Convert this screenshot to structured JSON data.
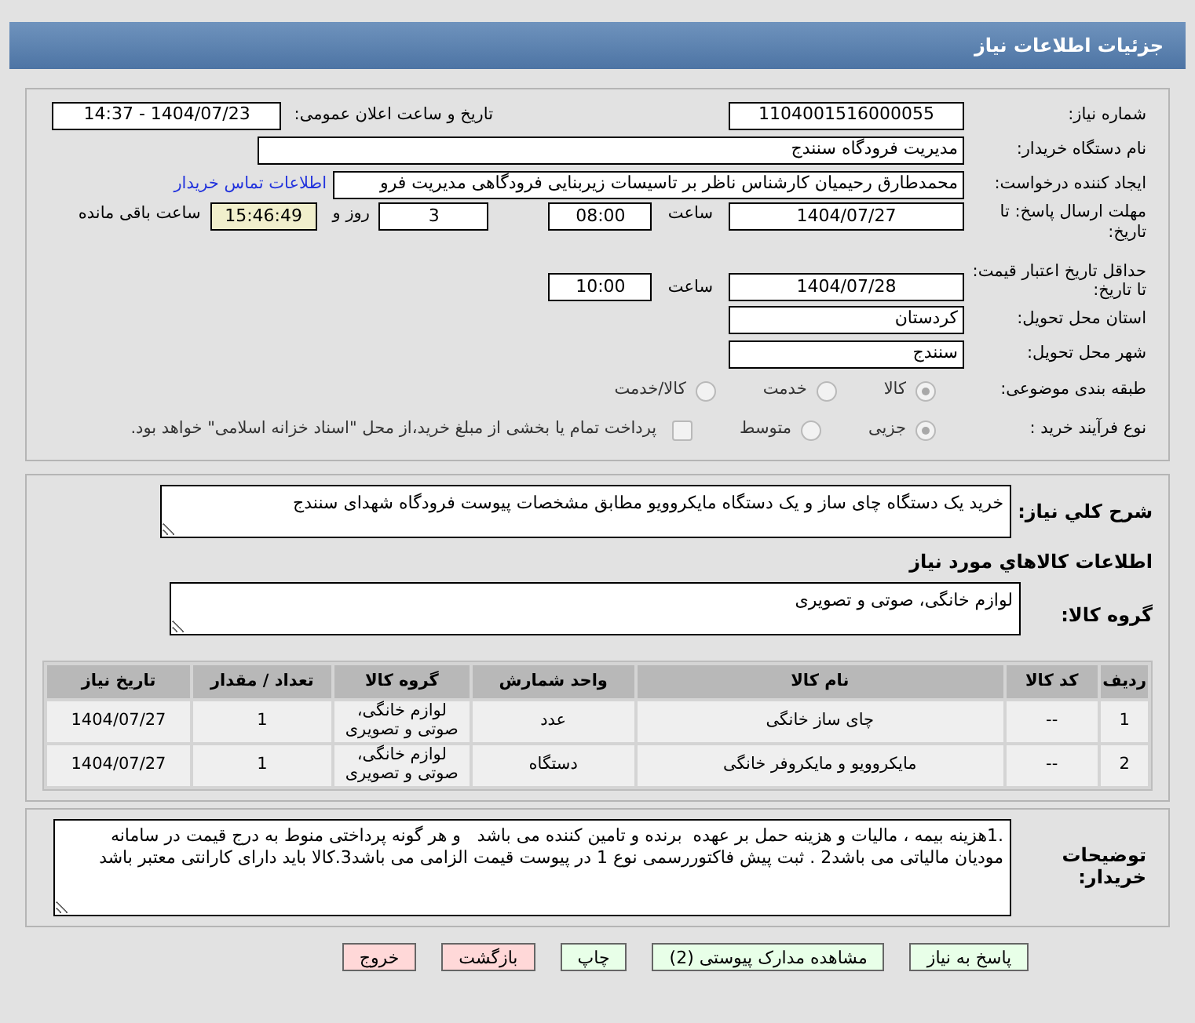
{
  "header": {
    "title": "جزئیات اطلاعات نیاز"
  },
  "need_number": {
    "label": "شماره نیاز:",
    "value": "1104001516000055"
  },
  "announce": {
    "label": "تاریخ و ساعت اعلان عمومی:",
    "value": "1404/07/23 - 14:37"
  },
  "buyer": {
    "label": "نام دستگاه خریدار:",
    "value": "مدیریت فرودگاه سنندج"
  },
  "requester": {
    "label": "ایجاد کننده درخواست:",
    "value": "محمدطارق رحیمیان کارشناس ناظر بر تاسیسات زیربنایی فرودگاهی مدیریت فرو",
    "link": "اطلاعات تماس خریدار"
  },
  "deadline": {
    "label": "مهلت ارسال پاسخ: تا تاریخ:",
    "date": "1404/07/27",
    "time_label": "ساعت",
    "time": "08:00",
    "days": "3",
    "days_label": "روز و",
    "remaining": "15:46:49",
    "remaining_label": "ساعت باقی مانده"
  },
  "validity": {
    "label": "حداقل تاریخ اعتبار قیمت: تا تاریخ:",
    "date": "1404/07/28",
    "time_label": "ساعت",
    "time": "10:00"
  },
  "province": {
    "label": "استان محل تحویل:",
    "value": "کردستان"
  },
  "city": {
    "label": "شهر محل تحویل:",
    "value": "سنندج"
  },
  "category": {
    "label": "طبقه بندی موضوعی:",
    "options": [
      {
        "label": "کالا",
        "selected": true
      },
      {
        "label": "خدمت",
        "selected": false
      },
      {
        "label": "کالا/خدمت",
        "selected": false
      }
    ]
  },
  "process": {
    "label": "نوع فرآیند خرید :",
    "options": [
      {
        "label": "جزیی",
        "selected": true
      },
      {
        "label": "متوسط",
        "selected": false
      }
    ],
    "treasury": {
      "label": "پرداخت تمام یا بخشی از مبلغ خرید،از محل \"اسناد خزانه اسلامی\" خواهد بود.",
      "checked": false
    }
  },
  "description": {
    "label": "شرح کلي نياز:",
    "value": "خرید یک دستگاه چای ساز و یک دستگاه مایکروویو مطابق مشخصات پیوست فرودگاه شهدای سنندج"
  },
  "goods_title": "اطلاعات کالاهاي مورد نياز",
  "goods_group": {
    "label": "گروه کالا:",
    "value": "لوازم خانگی، صوتی و تصویری"
  },
  "table": {
    "columns": [
      "ردیف",
      "کد کالا",
      "نام کالا",
      "واحد شمارش",
      "گروه کالا",
      "تعداد / مقدار",
      "تاریخ نیاز"
    ],
    "rows": [
      [
        "1",
        "--",
        "چای ساز خانگی",
        "عدد",
        "لوازم خانگی، صوتی و تصویری",
        "1",
        "1404/07/27"
      ],
      [
        "2",
        "--",
        "مایکروویو و مایکروفر خانگی",
        "دستگاه",
        "لوازم خانگی، صوتی و تصویری",
        "1",
        "1404/07/27"
      ]
    ]
  },
  "notes": {
    "label": "توضیحات خریدار:",
    "value": ".1هزینه بیمه ، مالیات و هزینه حمل بر عهده  برنده و تامین کننده می باشد   و هر گونه پرداختی منوط به درج قیمت در سامانه مودیان مالیاتی می باشد2 . ثبت پیش فاکتوررسمی نوع 1 در پیوست قیمت الزامی می باشد3.کالا باید دارای کارانتی معتبر باشد"
  },
  "buttons": [
    {
      "label": "پاسخ به نیاز",
      "color": "#e8ffe8"
    },
    {
      "label": "مشاهده مدارک پیوستی (2)",
      "color": "#e8ffe8"
    },
    {
      "label": "چاپ",
      "color": "#e8ffe8"
    },
    {
      "label": "بازگشت",
      "color": "#ffd8d8"
    },
    {
      "label": "خروج",
      "color": "#ffd8d8"
    }
  ]
}
